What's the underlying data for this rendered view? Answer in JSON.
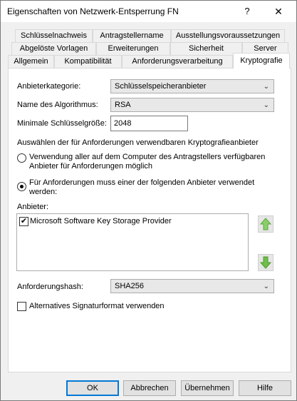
{
  "window": {
    "title": "Eigenschaften von Netzwerk-Entsperrung FN",
    "help_glyph": "?",
    "close_glyph": "✕"
  },
  "tabs": {
    "row1": [
      "Schlüsselnachweis",
      "Antragstellername",
      "Ausstellungsvoraussetzungen"
    ],
    "row2": [
      "Abgelöste Vorlagen",
      "Erweiterungen",
      "Sicherheit",
      "Server"
    ],
    "row3": [
      "Allgemein",
      "Kompatibilität",
      "Anforderungsverarbeitung",
      "Kryptografie"
    ],
    "active": "Kryptografie"
  },
  "form": {
    "provider_category_label": "Anbieterkategorie:",
    "provider_category_value": "Schlüsselspeicheranbieter",
    "algorithm_label": "Name des Algorithmus:",
    "algorithm_value": "RSA",
    "min_key_label": "Minimale Schlüsselgröße:",
    "min_key_value": "2048",
    "choose_heading": "Auswählen der für Anforderungen verwendbaren Kryptografieanbieter",
    "radio_any_line1": "Verwendung aller auf dem Computer des Antragstellers verfügbaren",
    "radio_any_line2": "Anbieter für Anforderungen möglich",
    "radio_one_line1": "Für Anforderungen muss einer der folgenden Anbieter verwendet",
    "radio_one_line2": "werden:",
    "selected_radio": "one",
    "providers_label": "Anbieter:",
    "providers": [
      {
        "name": "Microsoft Software Key Storage Provider",
        "checked": true
      }
    ],
    "hash_label": "Anforderungshash:",
    "hash_value": "SHA256",
    "alt_sig_label": "Alternatives Signaturformat verwenden",
    "alt_sig_checked": false
  },
  "icons": {
    "move_up": "arrow-up-icon",
    "move_down": "arrow-down-icon",
    "accent_green": "#6fbf4a"
  },
  "buttons": {
    "ok": "OK",
    "cancel": "Abbrechen",
    "apply": "Übernehmen",
    "help": "Hilfe"
  }
}
